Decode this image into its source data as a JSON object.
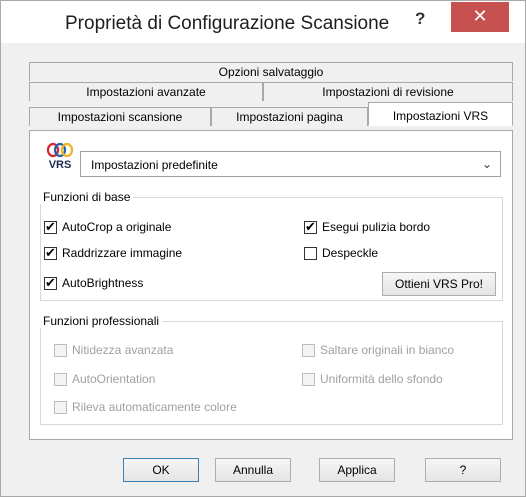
{
  "window": {
    "title": "Proprietà di Configurazione Scansione",
    "help_glyph": "?",
    "close_glyph": "✕"
  },
  "tabs": {
    "row1": [
      "Opzioni salvataggio"
    ],
    "row2": [
      "Impostazioni avanzate",
      "Impostazioni di revisione"
    ],
    "row3": [
      "Impostazioni scansione",
      "Impostazioni pagina",
      "Impostazioni VRS"
    ],
    "active": "Impostazioni VRS"
  },
  "vrs": {
    "logo_text": "VRS",
    "preset_value": "Impostazioni predefinite"
  },
  "basic": {
    "title": "Funzioni di base",
    "options": [
      {
        "label": "AutoCrop a originale",
        "checked": true
      },
      {
        "label": "Raddrizzare immagine",
        "checked": true
      },
      {
        "label": "AutoBrightness",
        "checked": true
      },
      {
        "label": "Esegui pulizia bordo",
        "checked": true
      },
      {
        "label": "Despeckle",
        "checked": false
      }
    ],
    "pro_button": "Ottieni VRS Pro!"
  },
  "pro": {
    "title": "Funzioni professionali",
    "options": [
      {
        "label": "Nitidezza avanzata",
        "checked": false
      },
      {
        "label": "AutoOrientation",
        "checked": false
      },
      {
        "label": "Rileva automaticamente colore",
        "checked": false
      },
      {
        "label": "Saltare originali in bianco",
        "checked": false
      },
      {
        "label": "Uniformità dello sfondo",
        "checked": false
      }
    ]
  },
  "buttons": {
    "ok": "OK",
    "cancel": "Annulla",
    "apply": "Applica",
    "help": "?"
  },
  "colors": {
    "close_red": "#c75050",
    "logo_red": "#d6262f",
    "logo_blue": "#2b5fab",
    "logo_yellow": "#f0b323"
  }
}
